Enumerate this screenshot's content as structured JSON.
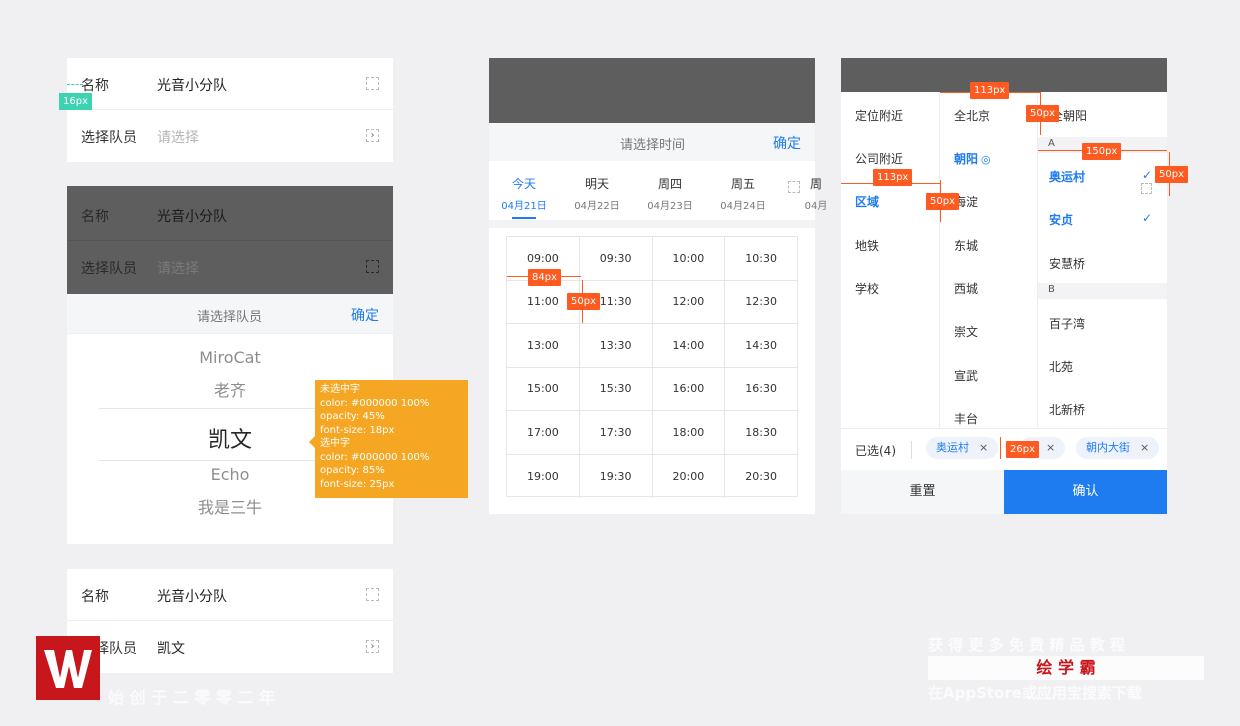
{
  "card1": {
    "name_label": "名称",
    "name_value": "光音小分队",
    "member_label": "选择队员",
    "member_placeholder": "请选择",
    "spacing_tag": "16px"
  },
  "card2": {
    "name_label": "名称",
    "name_value": "光音小分队",
    "member_label": "选择队员",
    "member_placeholder": "请选择",
    "picker_title": "请选择队员",
    "confirm_label": "确定",
    "options": [
      "MiroCat",
      "老齐",
      "凯文",
      "Echo",
      "我是三牛"
    ],
    "selected_index": 2
  },
  "spec_note": {
    "lines": [
      "未选中字",
      "color: #000000 100%",
      "opacity: 45%",
      "font-size: 18px",
      "选中字",
      "color: #000000 100%",
      "opacity: 85%",
      "font-size: 25px"
    ]
  },
  "card3": {
    "name_label": "名称",
    "name_value": "光音小分队",
    "member_label": "择队员",
    "member_value": "凯文"
  },
  "time_panel": {
    "title": "请选择时间",
    "confirm_label": "确定",
    "days": [
      {
        "day": "今天",
        "date": "04月21日",
        "active": true
      },
      {
        "day": "明天",
        "date": "04月22日",
        "active": false
      },
      {
        "day": "周四",
        "date": "04月23日",
        "active": false
      },
      {
        "day": "周五",
        "date": "04月24日",
        "active": false
      },
      {
        "day": "周",
        "date": "04月",
        "active": false
      }
    ],
    "slots": [
      [
        "09:00",
        "09:30",
        "10:00",
        "10:30"
      ],
      [
        "11:00",
        "11:30",
        "12:00",
        "12:30"
      ],
      [
        "13:00",
        "13:30",
        "14:00",
        "14:30"
      ],
      [
        "15:00",
        "15:30",
        "16:00",
        "16:30"
      ],
      [
        "17:00",
        "17:30",
        "18:00",
        "18:30"
      ],
      [
        "19:00",
        "19:30",
        "20:00",
        "20:30"
      ]
    ],
    "width_tag": "84px",
    "height_tag": "50px"
  },
  "area_panel": {
    "col1": [
      "定位附近",
      "公司附近",
      "区域",
      "地铁",
      "学校"
    ],
    "col1_active": 2,
    "col2": [
      "全北京",
      "朝阳",
      "海淀",
      "东城",
      "西城",
      "崇文",
      "宣武",
      "丰台"
    ],
    "col2_active": 1,
    "col3_top": "全朝阳",
    "section_a": "A",
    "section_b": "B",
    "col3_a": [
      {
        "name": "奥运村",
        "checked": true
      },
      {
        "name": "安贞",
        "checked": true
      },
      {
        "name": "安慧桥",
        "checked": false
      }
    ],
    "col3_b": [
      "百子湾",
      "北苑",
      "北新桥"
    ],
    "selected_label": "已选(4)",
    "chips": [
      "奥运村",
      "朝内大街"
    ],
    "chip_close": "×",
    "reset_label": "重置",
    "confirm_label": "确认",
    "tags": {
      "w113a": "113px",
      "w113b": "113px",
      "w150": "150px",
      "h50a": "50px",
      "h50b": "50px",
      "h50c": "50px",
      "h26": "26px"
    }
  },
  "watermark": {
    "line1": "获 得 更 多 免 费 精 品 教 程",
    "line2": "绘 学 霸",
    "line3": "在AppStore或应用宝搜索下载",
    "bottom_left": "始 创 于 二 零 零 二 年"
  },
  "colors": {
    "accent": "#1f7cf0",
    "measure": "#ff5a1f",
    "note": "#f5a623",
    "dark_overlay": "#5e5e5e"
  }
}
